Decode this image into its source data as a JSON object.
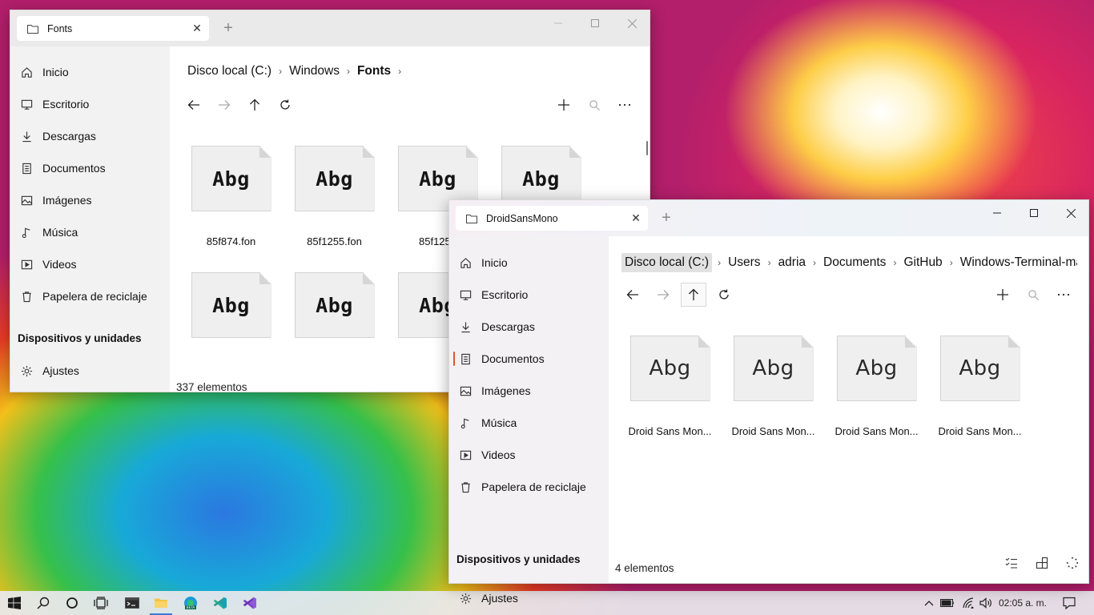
{
  "window1": {
    "tab_title": "Fonts",
    "breadcrumb": [
      "Disco local (C:)",
      "Windows",
      "Fonts"
    ],
    "sidebar": {
      "items": [
        "Inicio",
        "Escritorio",
        "Descargas",
        "Documentos",
        "Imágenes",
        "Música",
        "Videos",
        "Papelera de reciclaje"
      ],
      "section": "Dispositivos y unidades",
      "settings": "Ajustes"
    },
    "preview_text": "Abg",
    "files": [
      "85f874.fon",
      "85f1255.fon",
      "85f1256",
      "",
      "",
      "",
      "",
      ""
    ],
    "status": "337 elementos"
  },
  "window2": {
    "tab_title": "DroidSansMono",
    "breadcrumb": [
      "Disco local (C:)",
      "Users",
      "adria",
      "Documents",
      "GitHub",
      "Windows-Terminal-ma"
    ],
    "sidebar": {
      "items": [
        "Inicio",
        "Escritorio",
        "Descargas",
        "Documentos",
        "Imágenes",
        "Música",
        "Videos",
        "Papelera de reciclaje"
      ],
      "selected": "Documentos",
      "section": "Dispositivos y unidades",
      "settings": "Ajustes"
    },
    "preview_text": "Abg",
    "files": [
      "Droid Sans Mon...",
      "Droid Sans Mon...",
      "Droid Sans Mon...",
      "Droid Sans Mon..."
    ],
    "status": "4 elementos"
  },
  "taskbar": {
    "time": "02:05 a. m.",
    "accent_color": "#3a7ad9"
  },
  "colors": {
    "selection_indicator": "#d9582b"
  }
}
